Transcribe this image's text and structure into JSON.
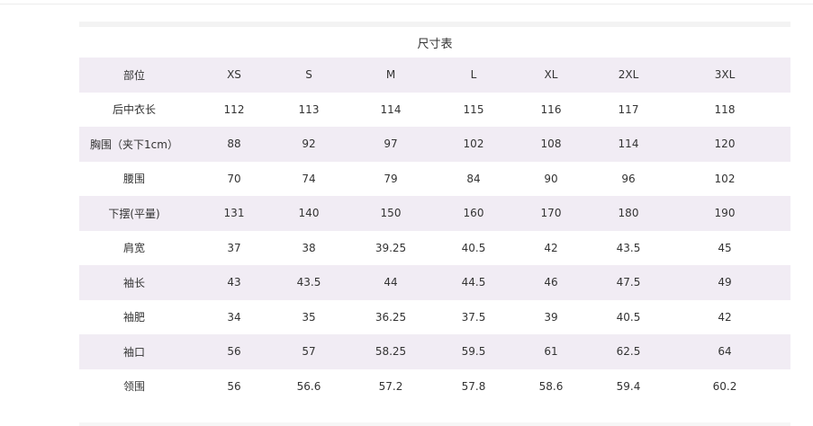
{
  "table": {
    "title": "尺寸表",
    "header": [
      "部位",
      "XS",
      "S",
      "M",
      "L",
      "XL",
      "2XL",
      "3XL"
    ],
    "rows": [
      [
        "后中衣长",
        "112",
        "113",
        "114",
        "115",
        "116",
        "117",
        "118"
      ],
      [
        "胸围（夹下1cm）",
        "88",
        "92",
        "97",
        "102",
        "108",
        "114",
        "120"
      ],
      [
        "腰围",
        "70",
        "74",
        "79",
        "84",
        "90",
        "96",
        "102"
      ],
      [
        "下摆(平量)",
        "131",
        "140",
        "150",
        "160",
        "170",
        "180",
        "190"
      ],
      [
        "肩宽",
        "37",
        "38",
        "39.25",
        "40.5",
        "42",
        "43.5",
        "45"
      ],
      [
        "袖长",
        "43",
        "43.5",
        "44",
        "44.5",
        "46",
        "47.5",
        "49"
      ],
      [
        "袖肥",
        "34",
        "35",
        "36.25",
        "37.5",
        "39",
        "40.5",
        "42"
      ],
      [
        "袖口",
        "56",
        "57",
        "58.25",
        "59.5",
        "61",
        "62.5",
        "64"
      ],
      [
        "领围",
        "56",
        "56.6",
        "57.2",
        "57.8",
        "58.6",
        "59.4",
        "60.2"
      ]
    ]
  },
  "colors": {
    "alt_row": "#f1ecf4",
    "text": "#333333"
  }
}
